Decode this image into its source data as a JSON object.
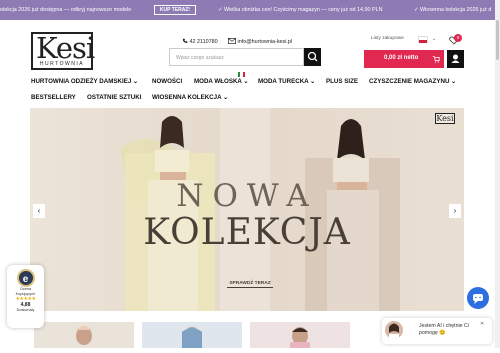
{
  "top_bar": {
    "msg_left": "olekcja 2026 już dostępna — odkryj najnowsze modele",
    "cta_label": "KUP TERAZ!",
    "msg_mid": "Wielka obniżka cen! Czyścimy magazyn — ceny już od 14,90 PLN",
    "msg_right": "Wiosenna kolekcja 2026 już d"
  },
  "logo": {
    "text": "Kesi",
    "subtitle": "HURTOWNIA"
  },
  "contact": {
    "phone": "42 2110780",
    "email": "info@hurtownia-kesi.pl"
  },
  "search": {
    "placeholder": "Wpisz czego szukasz"
  },
  "lang": {
    "label": "Listy zakupowe"
  },
  "cart": {
    "total": "0,00 zł netto",
    "count": "0"
  },
  "nav": {
    "items": [
      "HURTOWNIA ODZIEŻY DAMSKIEJ",
      "NOWOŚCI",
      "MODA WŁOSKA",
      "MODA TURECKA",
      "PLUS SIZE",
      "CZYSZCZENIE MAGAZYNU",
      "BESTSELLERY",
      "OSTATNIE SZTUKI",
      "WIOSENNA KOLEKCJA"
    ]
  },
  "hero": {
    "title_line1": "NOWA",
    "title_line2": "KOLEKCJA",
    "cta": "SPRAWDŹ TERAZ",
    "logo": "Kesi"
  },
  "badge": {
    "line1": "Ocena",
    "line2": "Kupujących",
    "stars": "★★★★★",
    "score": "4,88",
    "label": "Doskonały"
  },
  "chat": {
    "line1": "Jestem AI i chętnie Ci",
    "line2": "pomogę 😊"
  },
  "colors": {
    "accent": "#e02851",
    "topbar": "#8e7bb4",
    "chat": "#2d6ee0"
  }
}
